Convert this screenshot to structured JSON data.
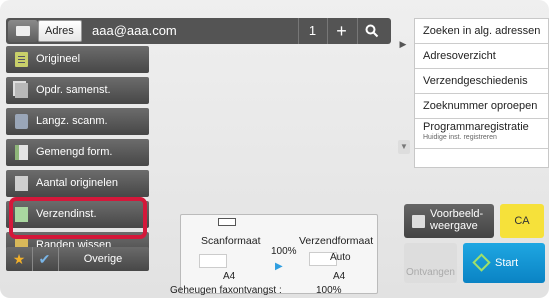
{
  "topbar": {
    "address_button": "Adres",
    "address_value": "aaa@aaa.com",
    "count": "1",
    "plus": "+"
  },
  "address_menu": [
    {
      "label": "Zoeken in alg. adressen"
    },
    {
      "label": "Adresoverzicht"
    },
    {
      "label": "Verzendgeschiedenis"
    },
    {
      "label": "Zoeknummer oproepen"
    },
    {
      "label": "Programmaregistratie",
      "sub": "Huidige inst. registreren"
    }
  ],
  "left_menu": [
    {
      "label": "Origineel"
    },
    {
      "label": "Opdr. samenst."
    },
    {
      "label": "Langz. scanm."
    },
    {
      "label": "Gemengd form."
    },
    {
      "label": "Aantal originelen"
    },
    {
      "label": "Verzendinst."
    },
    {
      "label": "Randen wissen"
    }
  ],
  "bottom": {
    "other_label": "Overige"
  },
  "info": {
    "scan_label": "Scanformaat",
    "send_label": "Verzendformaat",
    "ratio": "100%",
    "auto": "Auto",
    "scan_size": "A4",
    "send_size": "A4",
    "memory_label": "Geheugen faxontvangst :",
    "memory_value": "100%"
  },
  "actions": {
    "preview_label": "Voorbeeld-\nweergave",
    "ca_label": "CA",
    "receive_label": "Ontvangen",
    "start_label": "Start"
  },
  "colors": {
    "highlight": "#d4183a",
    "start": "#1396d6",
    "ca": "#f6e13a"
  }
}
